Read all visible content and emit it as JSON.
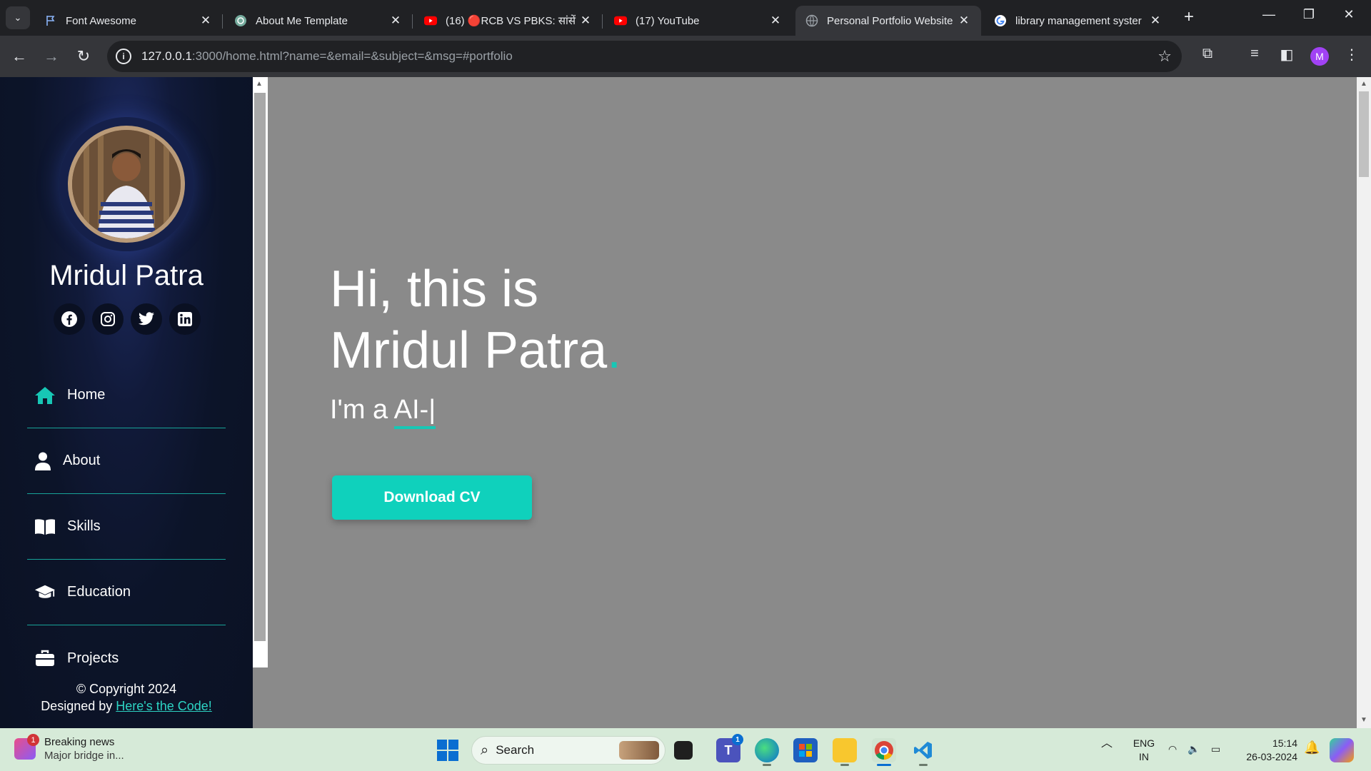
{
  "browser": {
    "tabs": [
      {
        "label": "Font Awesome",
        "icon": "flag-icon",
        "active": false
      },
      {
        "label": "About Me Template",
        "icon": "chatgpt-icon",
        "active": false
      },
      {
        "label": "(16) 🔴RCB VS PBKS: सांसें",
        "icon": "youtube-icon",
        "active": false
      },
      {
        "label": "(17) YouTube",
        "icon": "youtube-icon",
        "active": false
      },
      {
        "label": "Personal Portfolio Website",
        "icon": "globe-icon",
        "active": true
      },
      {
        "label": "library management syster",
        "icon": "google-icon",
        "active": false
      }
    ],
    "url_host": "127.0.0.1",
    "url_rest": ":3000/home.html?name=&email=&subject=&msg=#portfolio",
    "profile_initial": "M"
  },
  "sidebar": {
    "name": "Mridul Patra",
    "socials": [
      "facebook-icon",
      "instagram-icon",
      "twitter-icon",
      "linkedin-icon"
    ],
    "nav": [
      {
        "label": "Home",
        "icon": "home-icon"
      },
      {
        "label": "About",
        "icon": "user-icon"
      },
      {
        "label": "Skills",
        "icon": "book-icon"
      },
      {
        "label": "Education",
        "icon": "graduation-cap-icon"
      },
      {
        "label": "Projects",
        "icon": "briefcase-icon"
      }
    ],
    "copyright": "© Copyright 2024",
    "designed_by": "Designed by",
    "designer_link": "Here's the Code!"
  },
  "hero": {
    "line1": "Hi, this is",
    "line2": "Mridul Patra",
    "dot": ".",
    "typed_prefix": "I'm a ",
    "typed_word": "AI-",
    "cursor": "|",
    "cta": "Download CV"
  },
  "taskbar": {
    "news_title": "Breaking news",
    "news_sub": "Major bridge in...",
    "news_badge": "1",
    "search_placeholder": "Search",
    "teams_badge": "1",
    "lang_line1": "ENG",
    "lang_line2": "IN",
    "time": "15:14",
    "date": "26-03-2024"
  },
  "colors": {
    "accent": "#17c7b5",
    "button": "#0fd1bc",
    "page_bg": "#8a8a8a",
    "sidebar_bg": "#0b1224"
  }
}
